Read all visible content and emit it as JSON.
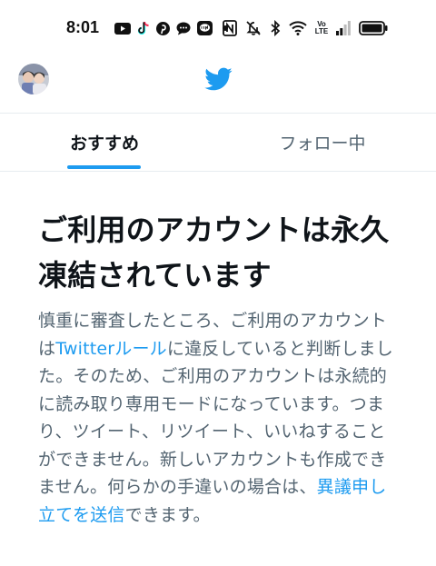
{
  "status_bar": {
    "time": "8:01",
    "icons_left": [
      "youtube-icon",
      "tiktok-icon",
      "pinterest-icon",
      "messaging-icon",
      "line-icon",
      "dot-icon"
    ],
    "icons_right": [
      "nfc-icon",
      "mute-icon",
      "bluetooth-icon",
      "wifi-icon",
      "volte-icon",
      "signal-icon",
      "battery-icon"
    ],
    "volte_label": "Vo LTE"
  },
  "header": {
    "avatar": "avatar",
    "logo": "twitter-bird-icon",
    "brand_color": "#1d9bf0"
  },
  "tabs": [
    {
      "label": "おすすめ",
      "active": true
    },
    {
      "label": "フォロー中",
      "active": false
    }
  ],
  "main": {
    "headline": "ご利用のアカウントは永久凍結されています",
    "body": {
      "part1": "慎重に審査したところ、ご利用のアカウントは",
      "link1": "Twitterルール",
      "part2": "に違反していると判断しました。そのため、ご利用のアカウントは永続的に読み取り専用モードになっています。つまり、ツイート、リツイート、いいねすることができません。新しいアカウントも作成できません。何らかの手違いの場合は、",
      "link2": "異議申し立てを送信",
      "part3": "できます。"
    }
  }
}
